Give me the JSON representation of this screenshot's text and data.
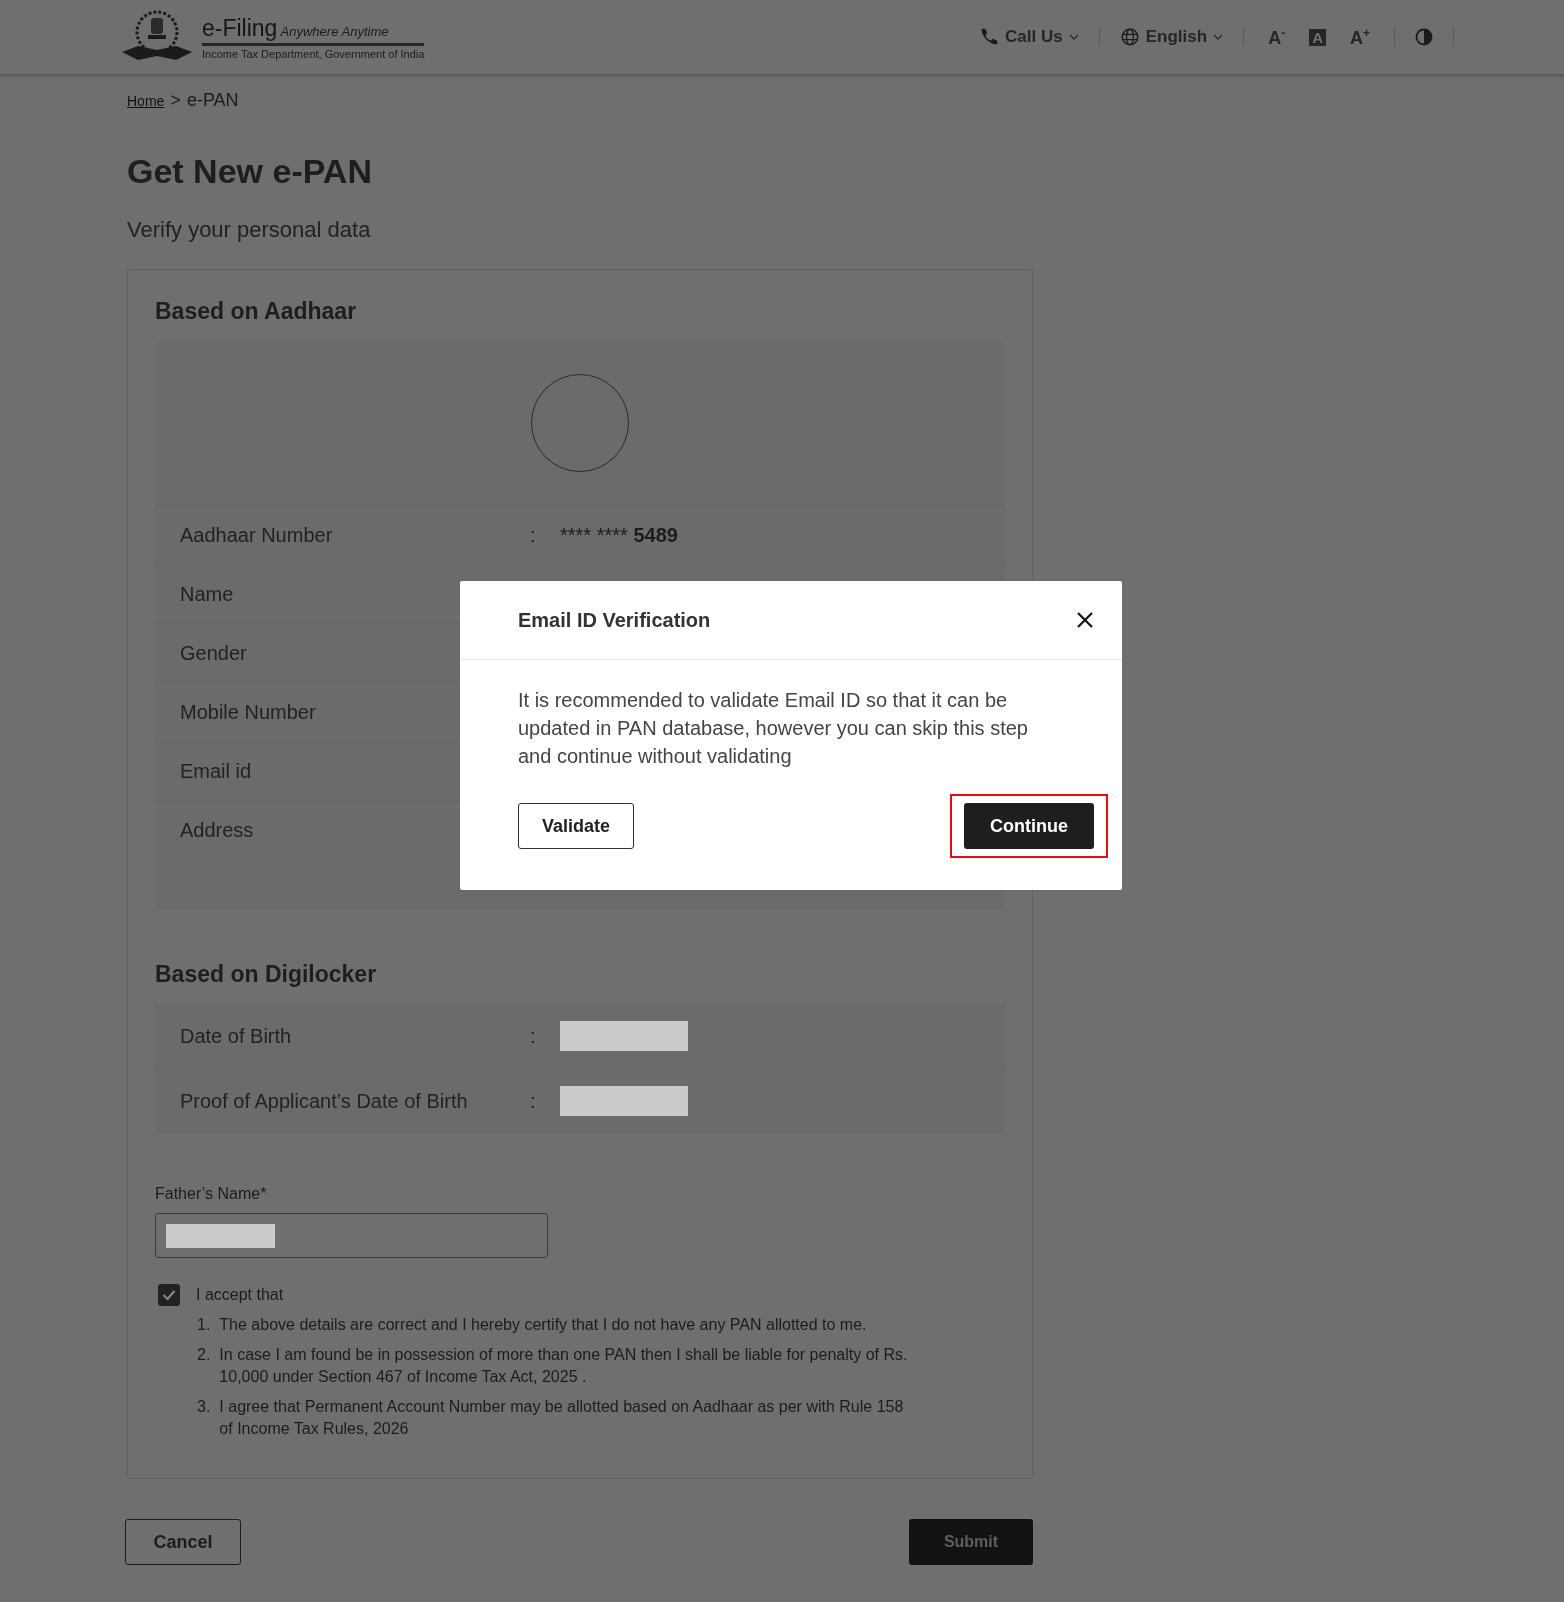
{
  "header": {
    "brand": "e-Filing",
    "tagline": "Anywhere Anytime",
    "department": "Income Tax Department, Government of India",
    "menus": [
      {
        "kind": "phone",
        "label": "Call Us"
      },
      {
        "kind": "globe",
        "label": "English"
      }
    ],
    "font_controls": [
      {
        "kind": "decrease",
        "label": "A$^{-}$"
      },
      {
        "kind": "normal",
        "label": "A"
      },
      {
        "kind": "increase",
        "label": "A$^{+}$"
      }
    ]
  },
  "breadcrumb": [
    {
      "label": "Home",
      "link": true
    },
    {
      "label": ">",
      "link": false
    },
    {
      "label": "e-PAN",
      "link": false
    }
  ],
  "title": "Get New e-PAN",
  "subtitle": "Verify your personal data",
  "sections": [
    {
      "heading": "Based on Aadhaar",
      "photo": true,
      "rows": [
        {
          "label": "Aadhaar Number",
          "separator": ":",
          "value_mask": "**** ****",
          "value": "5489"
        },
        {
          "label": "Name"
        },
        {
          "label": "Gender"
        },
        {
          "label": "Mobile Number"
        },
        {
          "label": "Email id"
        },
        {
          "label": "Address",
          "tall": true
        }
      ]
    },
    {
      "heading": "Based on Digilocker",
      "photo": false,
      "rows": [
        {
          "label": "Date of Birth",
          "separator": ":",
          "redacted": true
        },
        {
          "label": "Proof of Applicant’s Date of Birth",
          "separator": ":",
          "redacted": true
        }
      ]
    }
  ],
  "fathers_name": {
    "label": "Father’s Name*",
    "redacted": true
  },
  "consent": {
    "label": "I accept that",
    "checked": true,
    "items": [
      {
        "number": "1.",
        "text": "The above details are correct and I hereby certify that I do not have any PAN allotted to me."
      },
      {
        "number": "2.",
        "text": "In case I am found be in possession of more than one PAN then I shall be liable for penalty of Rs. 10,000 under Section 467 of Income Tax Act, 2025 ."
      },
      {
        "number": "3.",
        "text": "I agree that Permanent Account Number may be allotted based on Aadhaar as per with Rule 158 of Income Tax Rules, 2026"
      }
    ]
  },
  "buttons": [
    {
      "label": "Cancel",
      "kind": "outline"
    },
    {
      "label": "Submit",
      "kind": "primary"
    }
  ],
  "dialog": {
    "title": "Email ID Verification",
    "message": "It is recommended to validate Email ID so that it can be updated in PAN database, however you can skip this step and continue without validating",
    "buttons": [
      {
        "label": "Validate",
        "kind": "outline",
        "highlighted": false
      },
      {
        "label": "Continue",
        "kind": "primary",
        "highlighted": true
      }
    ]
  }
}
